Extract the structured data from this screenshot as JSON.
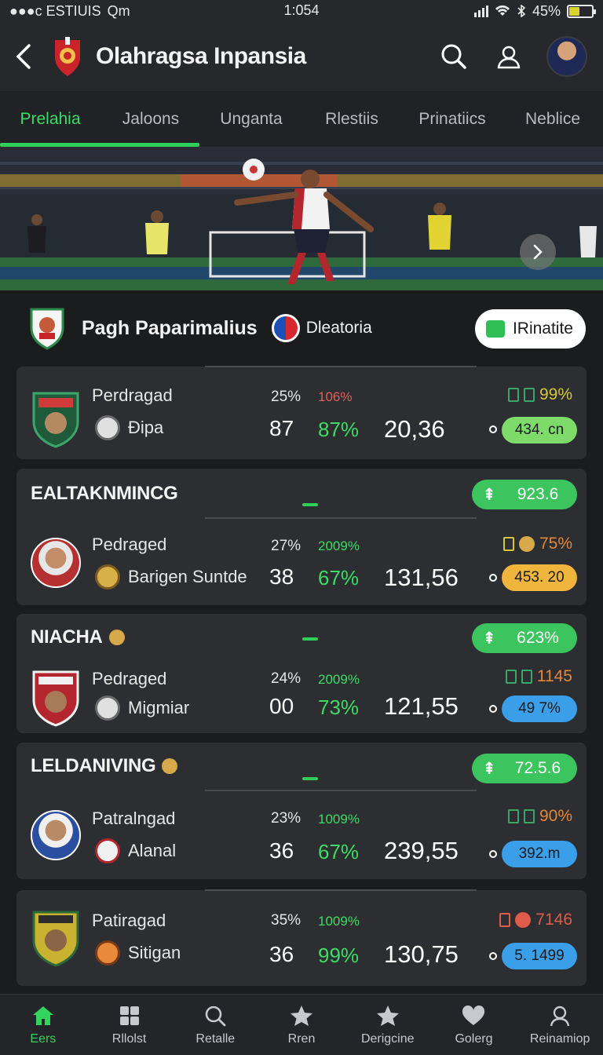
{
  "status_bar": {
    "carrier": "●●●c ESTIUIS",
    "app": "Qm",
    "time": "1:054",
    "battery": "45%",
    "battery_level": 0.45
  },
  "header": {
    "title": "Olahragsa Inpansia",
    "back_icon": "chevron-left-icon",
    "search_icon": "search-icon",
    "profile_icon": "user-icon"
  },
  "tabs": [
    {
      "label": "Prelahia",
      "active": true
    },
    {
      "label": "Jaloons"
    },
    {
      "label": "Unganta"
    },
    {
      "label": "Rlestiis"
    },
    {
      "label": "Prinatiics"
    },
    {
      "label": "Neblice"
    }
  ],
  "match": {
    "title": "Pagh Paparimalius",
    "sponsor": "Dleatoria",
    "cta_label": "IRinatite"
  },
  "cards": [
    {
      "player": "Perdragad",
      "club": "Ðipa",
      "pct_a": "25%",
      "pct_b": "106%",
      "n_a": "87",
      "n_b": "87%",
      "score": "20,36",
      "meta": "99%",
      "chip": "434. cn",
      "colors": {
        "pct_b": "#e0605a",
        "meta": "#d7c63a",
        "chip": "#7edb6a"
      }
    },
    {
      "section": "EALTAKNMINCG",
      "pill": "923.6",
      "player": "Pedraged",
      "club": "Barigen Suntde",
      "pct_a": "27%",
      "pct_b": "2009%",
      "n_a": "38",
      "n_b": "67%",
      "score": "131,56",
      "meta": "75%",
      "chip": "453. 20",
      "colors": {
        "pct_b": "#3ddc64",
        "meta": "#e5873a",
        "chip": "#f0b53c"
      }
    },
    {
      "section": "NIACHA",
      "pill": "623%",
      "player": "Pedraged",
      "club": "Migmiar",
      "pct_a": "24%",
      "pct_b": "2009%",
      "n_a": "00",
      "n_b": "73%",
      "score": "121,55",
      "meta": "1145",
      "chip": "49 7%",
      "colors": {
        "pct_b": "#3ddc64",
        "meta": "#e5873a",
        "chip": "#3b9ee8"
      }
    },
    {
      "section": "LELDANIVING",
      "pill": "72.5.6",
      "player": "Patralngad",
      "club": "Alanal",
      "pct_a": "23%",
      "pct_b": "1009%",
      "n_a": "36",
      "n_b": "67%",
      "score": "239,55",
      "meta": "90%",
      "chip": "392.m",
      "colors": {
        "pct_b": "#3ddc64",
        "meta": "#e5873a",
        "chip": "#3b9ee8"
      }
    },
    {
      "player": "Patiragad",
      "club": "Sitigan",
      "pct_a": "35%",
      "pct_b": "1009%",
      "n_a": "36",
      "n_b": "99%",
      "score": "130,75",
      "meta": "7146",
      "chip": "5. 1499",
      "colors": {
        "pct_b": "#3ddc64",
        "meta": "#e05b4a",
        "chip": "#3b9ee8"
      }
    }
  ],
  "bottom_nav": [
    {
      "label": "Eers",
      "icon": "home-icon",
      "active": true
    },
    {
      "label": "Rllolst",
      "icon": "grid-icon"
    },
    {
      "label": "Retalle",
      "icon": "search-icon"
    },
    {
      "label": "Rren",
      "icon": "star-icon"
    },
    {
      "label": "Derigcine",
      "icon": "star-icon"
    },
    {
      "label": "Golerg",
      "icon": "heart-icon"
    },
    {
      "label": "Reinamiop",
      "icon": "user-icon"
    }
  ]
}
